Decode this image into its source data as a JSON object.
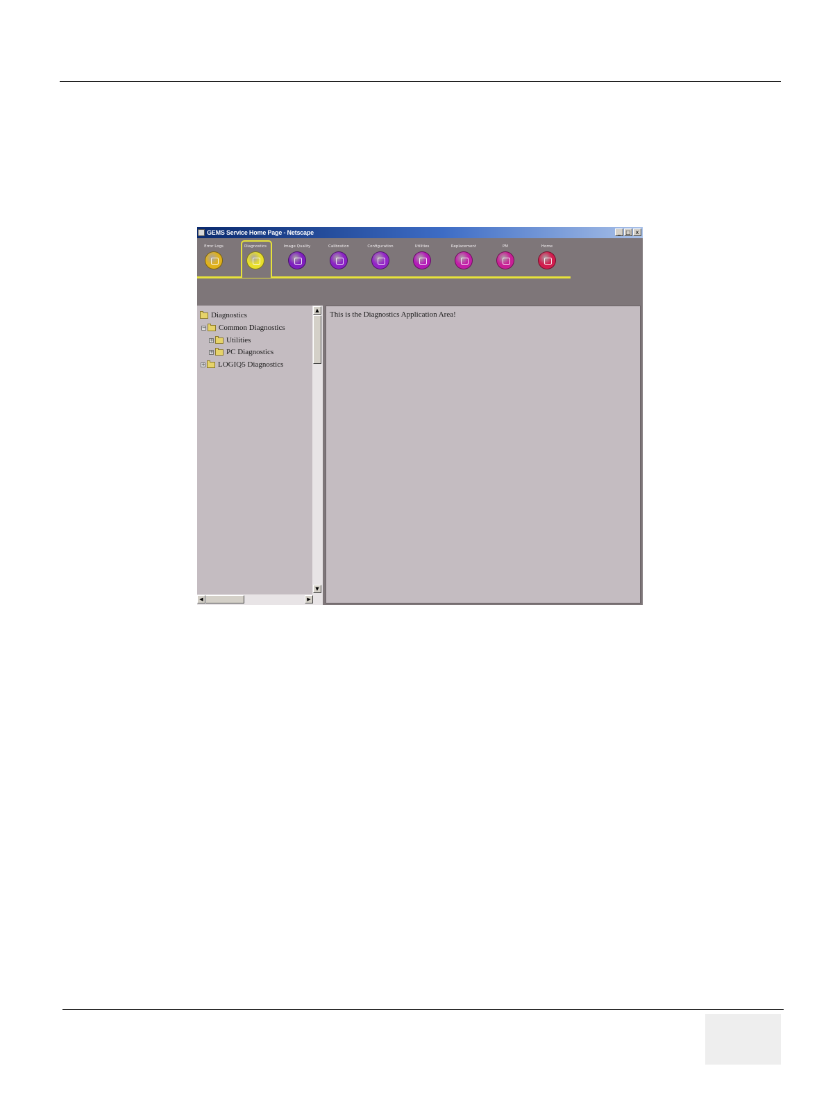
{
  "window": {
    "title": "GEMS Service Home Page - Netscape",
    "controls": [
      "_",
      "□",
      "x"
    ]
  },
  "toolbar": {
    "selected": "Diagnostics",
    "tools": [
      {
        "label": "Error Logs",
        "icon": "error-logs-icon",
        "color": "#e0b21c"
      },
      {
        "label": "Diagnostics",
        "icon": "diagnostics-icon",
        "color": "#e8df2b"
      },
      {
        "label": "Image Quality",
        "icon": "image-quality-icon",
        "color": "#7f1fbf"
      },
      {
        "label": "Calibration",
        "icon": "calibration-icon",
        "color": "#8a22c4"
      },
      {
        "label": "Configuration",
        "icon": "configuration-icon",
        "color": "#9324c7"
      },
      {
        "label": "Utilities",
        "icon": "utilities-icon",
        "color": "#b31ab8"
      },
      {
        "label": "Replacement",
        "icon": "replacement-icon",
        "color": "#c31ea8"
      },
      {
        "label": "PM",
        "icon": "pm-icon",
        "color": "#c91f96"
      },
      {
        "label": "Home",
        "icon": "home-icon",
        "color": "#d11d4e"
      }
    ]
  },
  "tree": {
    "items": [
      {
        "label": "Diagnostics",
        "expander": ""
      },
      {
        "label": "Common Diagnostics",
        "expander": "−"
      },
      {
        "label": "Utilities",
        "expander": "+"
      },
      {
        "label": "PC Diagnostics",
        "expander": "+"
      },
      {
        "label": "LOGIQ5 Diagnostics",
        "expander": "+"
      }
    ]
  },
  "app_area": {
    "text": "This is the Diagnostics Application Area!"
  }
}
